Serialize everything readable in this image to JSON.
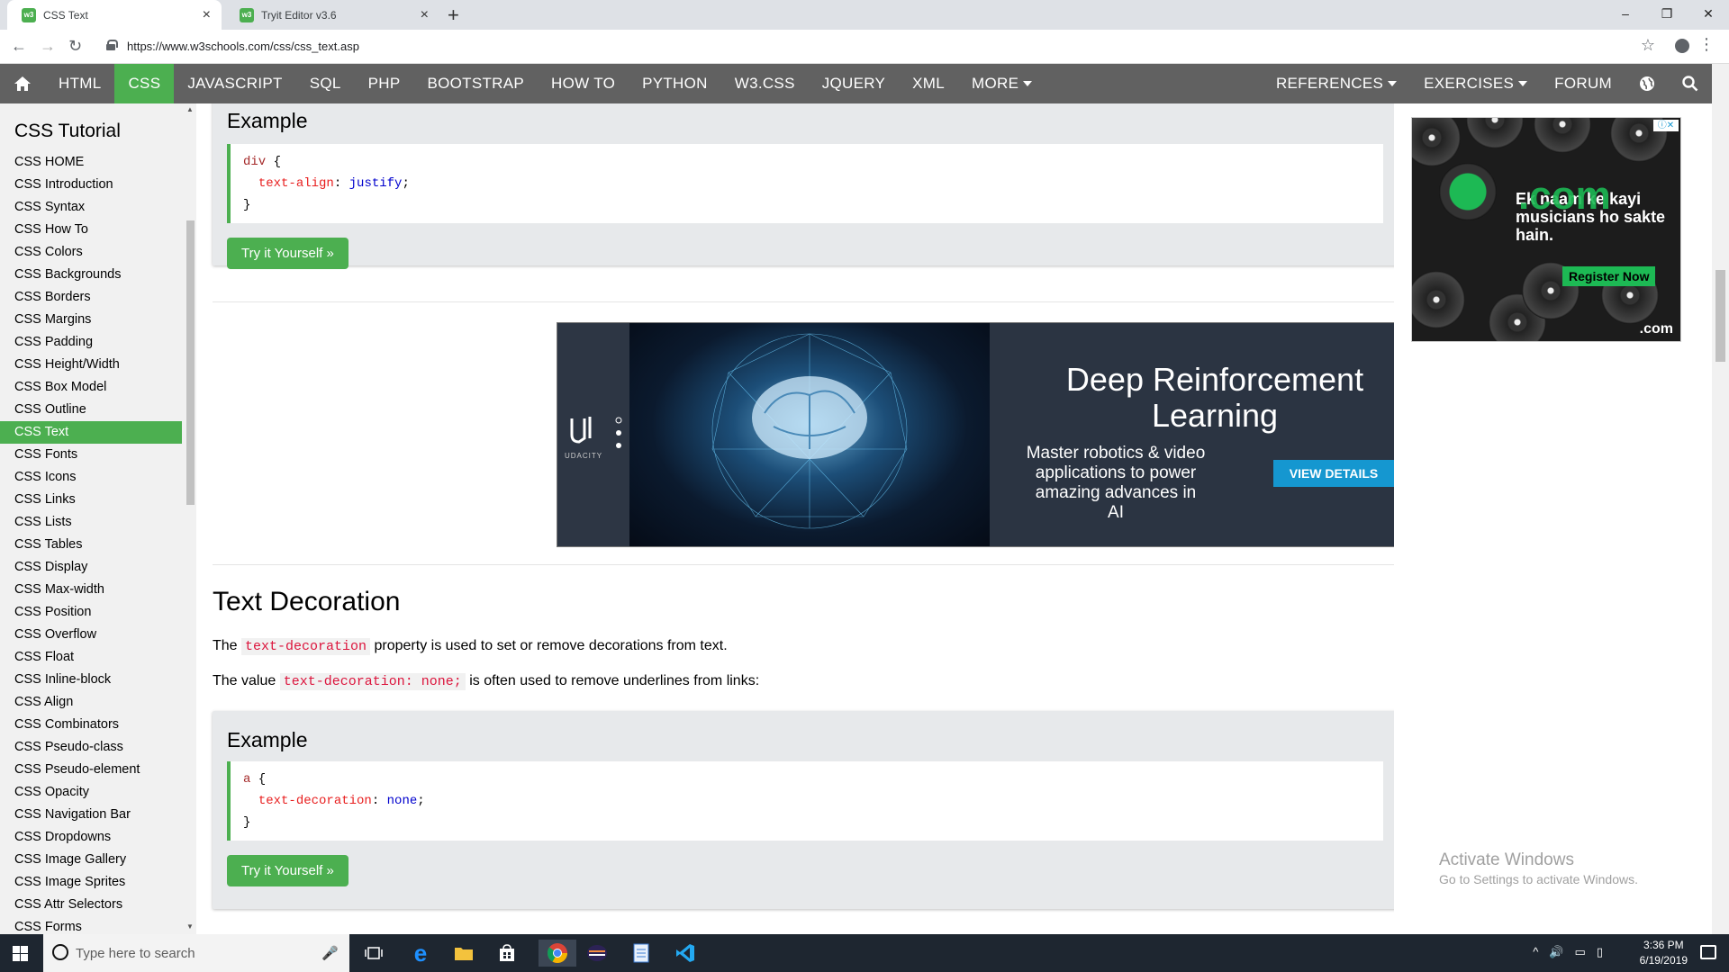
{
  "browser": {
    "tabs": [
      {
        "title": "CSS Text",
        "favicon": "w3"
      },
      {
        "title": "Tryit Editor v3.6",
        "favicon": "w3"
      }
    ],
    "url": "https://www.w3schools.com/css/css_text.asp"
  },
  "topnav": {
    "items": [
      "HTML",
      "CSS",
      "JAVASCRIPT",
      "SQL",
      "PHP",
      "BOOTSTRAP",
      "HOW TO",
      "PYTHON",
      "W3.CSS",
      "JQUERY",
      "XML",
      "MORE"
    ],
    "active": "CSS",
    "right_items": [
      "REFERENCES",
      "EXERCISES",
      "FORUM"
    ]
  },
  "sidebar": {
    "title": "CSS Tutorial",
    "items": [
      "CSS HOME",
      "CSS Introduction",
      "CSS Syntax",
      "CSS How To",
      "CSS Colors",
      "CSS Backgrounds",
      "CSS Borders",
      "CSS Margins",
      "CSS Padding",
      "CSS Height/Width",
      "CSS Box Model",
      "CSS Outline",
      "CSS Text",
      "CSS Fonts",
      "CSS Icons",
      "CSS Links",
      "CSS Lists",
      "CSS Tables",
      "CSS Display",
      "CSS Max-width",
      "CSS Position",
      "CSS Overflow",
      "CSS Float",
      "CSS Inline-block",
      "CSS Align",
      "CSS Combinators",
      "CSS Pseudo-class",
      "CSS Pseudo-element",
      "CSS Opacity",
      "CSS Navigation Bar",
      "CSS Dropdowns",
      "CSS Image Gallery",
      "CSS Image Sprites",
      "CSS Attr Selectors",
      "CSS Forms"
    ],
    "active": "CSS Text"
  },
  "example1": {
    "heading": "Example",
    "code": {
      "selector": "div",
      "property": "text-align",
      "value": "justify"
    },
    "button": "Try it Yourself »"
  },
  "ad_banner": {
    "brand": "UDACITY",
    "headline": "Deep Reinforcement Learning",
    "subtext": "Master robotics & video applications to power amazing advances in AI",
    "button": "VIEW DETAILS"
  },
  "section": {
    "title": "Text Decoration",
    "p1_before": "The ",
    "p1_code": "text-decoration",
    "p1_after": " property is used to set or remove decorations from text.",
    "p2_before": "The value ",
    "p2_code": "text-decoration: none;",
    "p2_after": " is often used to remove underlines from links:"
  },
  "example2": {
    "heading": "Example",
    "code": {
      "selector": "a",
      "property": "text-decoration",
      "value": "none"
    },
    "button": "Try it Yourself »"
  },
  "side_ad": {
    "text": "Ek naam ke kayi musicians ho sakte hain.",
    "domain": ".com",
    "button": "Register Now"
  },
  "watermark": {
    "line1": "Activate Windows",
    "line2": "Go to Settings to activate Windows."
  },
  "taskbar": {
    "search_placeholder": "Type here to search",
    "time": "3:36 PM",
    "date": "6/19/2019"
  },
  "colors": {
    "accent": "#4caf50",
    "topnav_bg": "#616161",
    "sidebar_bg": "#f1f1f1",
    "code_red": "#dc143c"
  }
}
